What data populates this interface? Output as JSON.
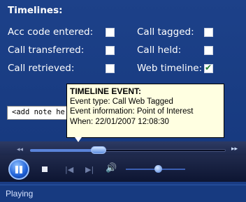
{
  "timelines": {
    "title": "Timelines:",
    "options": [
      {
        "label": "Acc code entered:",
        "checked": false
      },
      {
        "label": "Call tagged:",
        "checked": false
      },
      {
        "label": "Call transferred:",
        "checked": false
      },
      {
        "label": "Call held:",
        "checked": false
      },
      {
        "label": "Call retrieved:",
        "checked": false
      },
      {
        "label": "Web timeline:",
        "checked": true
      }
    ]
  },
  "note": {
    "value": "<add note he"
  },
  "tooltip": {
    "heading": "TIMELINE EVENT:",
    "event_type": "Event type: Call Web Tagged",
    "event_info": "Event information: Point of Interest",
    "when": "When: 22/01/2007 12:08:30"
  },
  "player": {
    "seek_position": 0.35,
    "volume_level": 0.55,
    "rewind_glyph": "◂◂",
    "forward_glyph": "▸▸",
    "prev_glyph": "|◀",
    "next_glyph": "▶|",
    "volume_glyph": "🔊"
  },
  "status": {
    "text": "Playing"
  },
  "colors": {
    "background": "#1a3c84",
    "tooltip_bg": "#ffffe1",
    "accent": "#5a83d9",
    "checkmark": "#1b7a2a"
  },
  "icons": [
    "pause-icon",
    "stop-icon",
    "previous-icon",
    "next-icon",
    "volume-icon",
    "timeline-marker-icon",
    "checkmark-icon"
  ]
}
